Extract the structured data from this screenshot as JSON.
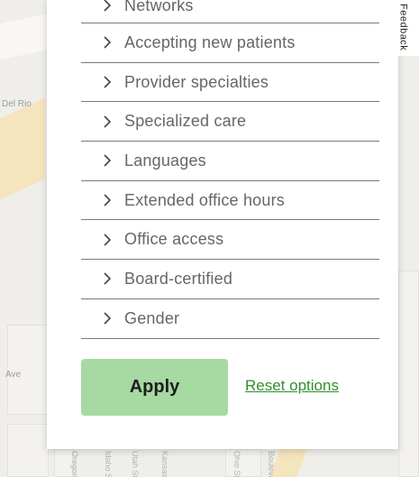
{
  "map": {
    "labels": [
      "Del Rio",
      "Ave"
    ],
    "streets": [
      "Oregon",
      "Idaho St",
      "Utah St",
      "Kansas",
      "Ohio St",
      "Boulevard"
    ]
  },
  "filters": [
    {
      "label": "Networks"
    },
    {
      "label": "Accepting new patients"
    },
    {
      "label": "Provider specialties"
    },
    {
      "label": "Specialized care"
    },
    {
      "label": "Languages"
    },
    {
      "label": "Extended office hours"
    },
    {
      "label": "Office access"
    },
    {
      "label": "Board-certified"
    },
    {
      "label": "Gender"
    }
  ],
  "actions": {
    "apply_label": "Apply",
    "reset_label": "Reset options"
  },
  "feedback": {
    "label": "Feedback"
  },
  "colors": {
    "apply_bg": "#a7d9a3",
    "link": "#2f8f2f",
    "divider": "#7a7a7a"
  }
}
